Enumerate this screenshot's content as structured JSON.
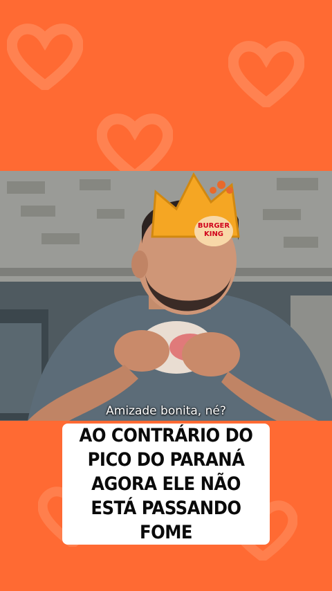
{
  "video": {
    "subtitle": "Amizade bonita, né?",
    "crown_logo_line1": "BURGER",
    "crown_logo_line2": "KING"
  },
  "caption": {
    "text": "AO CONTRÁRIO DO PICO DO PARANÁ AGORA ELE NÃO ESTÁ PASSANDO FOME"
  },
  "colors": {
    "background": "#FF6A33",
    "caption_bg": "#FFFFFF",
    "caption_text": "#0A0A0A",
    "crown": "#F5A623"
  },
  "decorations": {
    "background_icon": "heart-icon"
  }
}
